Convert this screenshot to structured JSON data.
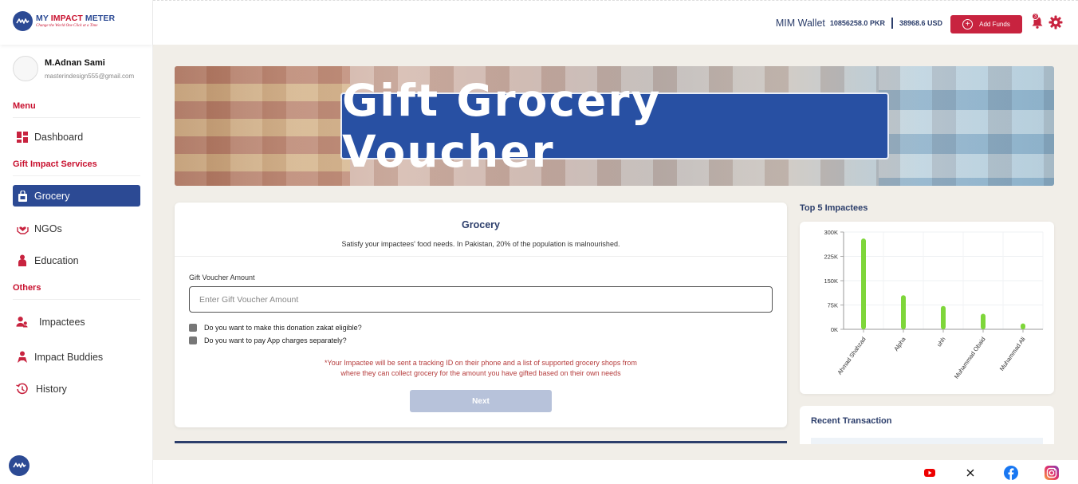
{
  "brand": {
    "name_part1": "MY ",
    "name_part2": "IMPACT",
    "name_part3": " METER",
    "tagline": "Change the World One Click at a Time"
  },
  "user": {
    "name": "M.Adnan Sami",
    "email": "masterindesign555@gmail.com"
  },
  "sidebar": {
    "menu_heading": "Menu",
    "dashboard": "Dashboard",
    "services_heading": "Gift Impact Services",
    "grocery": "Grocery",
    "ngos": "NGOs",
    "education": "Education",
    "others_heading": "Others",
    "impactees": "Impactees",
    "impact_buddies": "Impact Buddies",
    "history": "History"
  },
  "header": {
    "wallet_label": "MIM Wallet",
    "pkr_balance": "10856258.0 PKR",
    "usd_balance": "38968.6 USD",
    "add_funds": "Add Funds",
    "notification_count": "3"
  },
  "banner": {
    "title": "Gift Grocery Voucher"
  },
  "form": {
    "title": "Grocery",
    "subtitle": "Satisfy your impactees' food needs. In Pakistan, 20% of the population is malnourished.",
    "amount_label": "Gift Voucher Amount",
    "amount_placeholder": "Enter Gift Voucher Amount",
    "zakat_question": "Do you want to make this donation zakat eligible?",
    "app_charges_question": "Do you want to pay App charges separately?",
    "note_line1": "*Your Impactee will be sent a tracking ID on their phone and a list of supported grocery shops from",
    "note_line2": "where they can collect grocery for the amount you have gifted based on their own needs",
    "next_label": "Next"
  },
  "top5": {
    "heading": "Top 5 Impactees"
  },
  "recent": {
    "heading": "Recent Transaction"
  },
  "colors": {
    "primary": "#2c4a94",
    "accent": "#c8233f",
    "bar": "#7ed63a"
  },
  "chart_data": {
    "type": "bar",
    "categories": [
      "Ahmad Shahzad",
      "Alpha",
      "uhh",
      "Muhammad Obaid",
      "Muhammad Ali"
    ],
    "values": [
      280000,
      105000,
      72000,
      48000,
      18000
    ],
    "yticks": [
      "0K",
      "75K",
      "150K",
      "225K",
      "300K"
    ],
    "ylim": [
      0,
      300000
    ],
    "grid": true,
    "title": "",
    "xlabel": "",
    "ylabel": ""
  },
  "footer": {
    "icons": [
      "youtube-icon",
      "x-icon",
      "facebook-icon",
      "instagram-icon"
    ]
  }
}
